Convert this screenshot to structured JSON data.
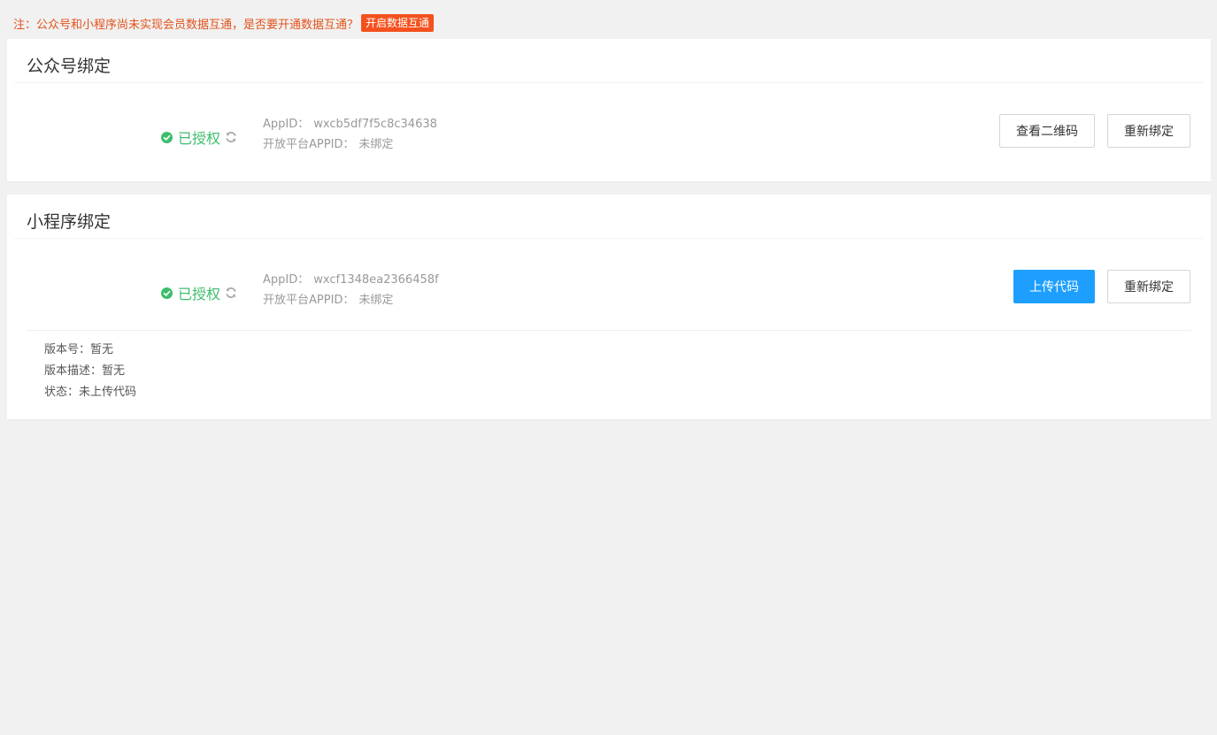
{
  "notice": {
    "text": "注：公众号和小程序尚未实现会员数据互通，是否要开通数据互通？",
    "link_label": "开启数据互通",
    "link_color": "#f4511e"
  },
  "wechat_official": {
    "title": "公众号绑定",
    "auth_status": "已授权",
    "appid_label": "AppID：",
    "appid_value": "wxcb5df7f5c8c34638",
    "open_platform_label": "开放平台APPID：",
    "open_platform_value": "未绑定",
    "view_qr_label": "查看二维码",
    "rebind_label": "重新绑定"
  },
  "mini_program": {
    "title": "小程序绑定",
    "auth_status": "已授权",
    "appid_label": "AppID：",
    "appid_value": "wxcf1348ea2366458f",
    "open_platform_label": "开放平台APPID：",
    "open_platform_value": "未绑定",
    "upload_label": "上传代码",
    "rebind_label": "重新绑定",
    "version_no": "版本号：暂无",
    "version_desc": "版本描述：暂无",
    "status": "状态：未上传代码"
  },
  "colors": {
    "authorized": "#3cbd6b",
    "primary": "#1e9fff",
    "notice": "#e4521b"
  },
  "icons": {
    "check": "check-circle-icon",
    "refresh": "refresh-icon"
  }
}
